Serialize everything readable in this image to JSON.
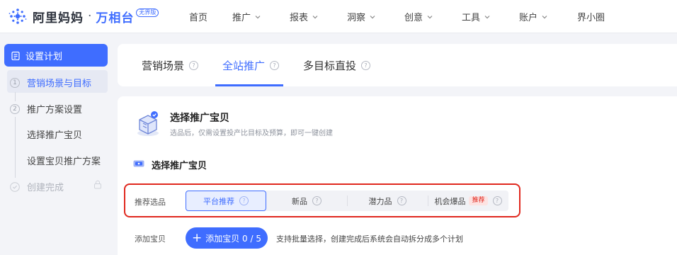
{
  "brand": {
    "name": "阿里妈妈",
    "dot": "·",
    "product": "万相台",
    "badge": "无界版"
  },
  "nav": [
    {
      "label": "首页",
      "dropdown": false
    },
    {
      "label": "推广",
      "dropdown": true
    },
    {
      "label": "报表",
      "dropdown": true
    },
    {
      "label": "洞察",
      "dropdown": true
    },
    {
      "label": "创意",
      "dropdown": true
    },
    {
      "label": "工具",
      "dropdown": true
    },
    {
      "label": "账户",
      "dropdown": true
    },
    {
      "label": "界小圈",
      "dropdown": false
    }
  ],
  "sidebar": {
    "header": "设置计划",
    "steps": [
      {
        "num": "1",
        "label": "营销场景与目标",
        "state": "current"
      },
      {
        "num": "2",
        "label": "推广方案设置",
        "state": "todo"
      },
      {
        "num": "",
        "label": "创建完成",
        "state": "disabled"
      }
    ],
    "substeps": [
      "选择推广宝贝",
      "设置宝贝推广方案"
    ]
  },
  "tabs": [
    {
      "label": "营销场景",
      "active": false
    },
    {
      "label": "全站推广",
      "active": true
    },
    {
      "label": "多目标直投",
      "active": false
    }
  ],
  "section": {
    "title": "选择推广宝贝",
    "subtitle": "选品后，仅需设置投产比目标及预算，即可一键创建",
    "subsection_title": "选择推广宝贝"
  },
  "recommend": {
    "label": "推荐选品",
    "options": [
      {
        "label": "平台推荐",
        "active": true,
        "badge": ""
      },
      {
        "label": "新品",
        "active": false,
        "badge": ""
      },
      {
        "label": "潜力品",
        "active": false,
        "badge": ""
      },
      {
        "label": "机会爆品",
        "active": false,
        "badge": "推荐"
      }
    ]
  },
  "add": {
    "label": "添加宝贝",
    "button": "添加宝贝 0 / 5",
    "hint": "支持批量选择，创建完成后系统会自动拆分成多个计划"
  },
  "colors": {
    "accent": "#3f6dff",
    "highlight_frame": "#e0281e",
    "badge_red": "#e0281e"
  },
  "icons": {
    "logo": "alimama-logo-icon",
    "caret": "chevron-down-icon",
    "help": "question-circle-icon",
    "clipboard": "clipboard-icon",
    "lock": "lock-icon",
    "box": "product-box-icon",
    "plus": "plus-icon"
  }
}
